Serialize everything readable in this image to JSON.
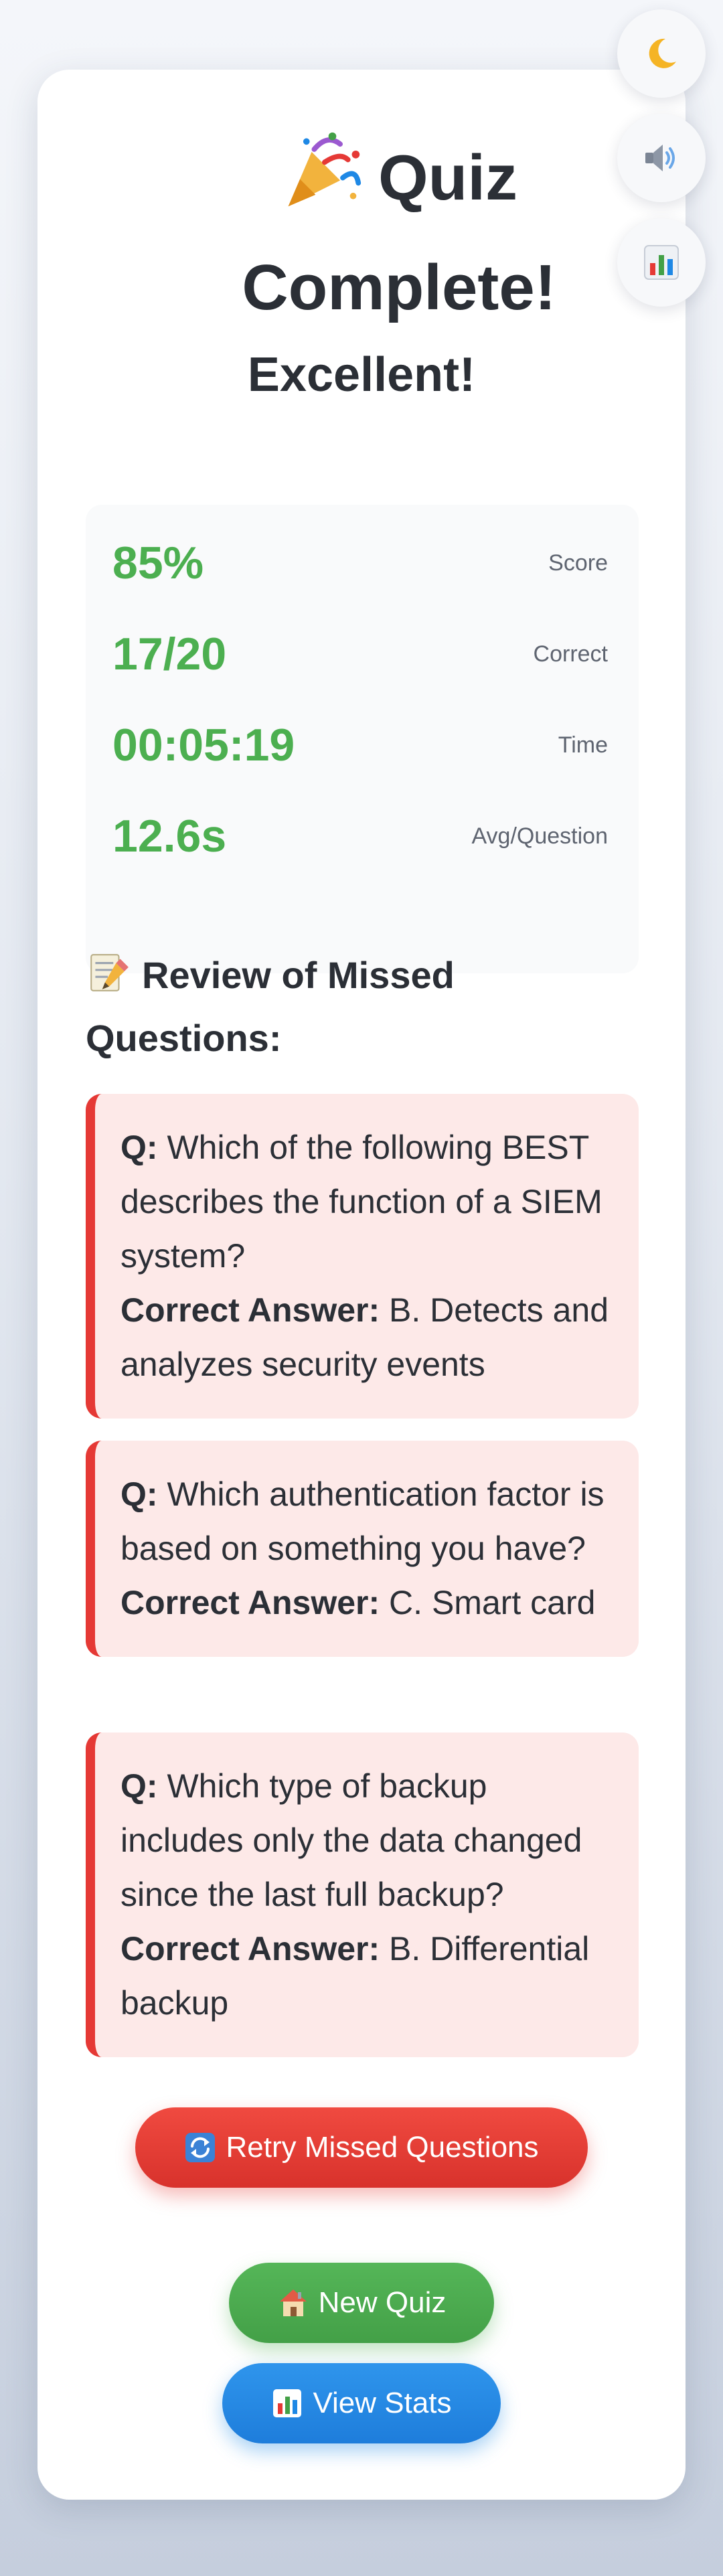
{
  "controls": {
    "theme_icon": "crescent-moon-icon",
    "sound_icon": "speaker-icon",
    "stats_icon": "bar-chart-icon"
  },
  "header": {
    "title_icon": "party-popper-icon",
    "title": "Quiz Complete!",
    "subtitle": "Excellent!"
  },
  "stats": [
    {
      "value": "85%",
      "label": "Score"
    },
    {
      "value": "17/20",
      "label": "Correct"
    },
    {
      "value": "00:05:19",
      "label": "Time"
    },
    {
      "value": "12.6s",
      "label": "Avg/Question"
    }
  ],
  "review": {
    "icon": "memo-icon",
    "heading": "Review of Missed Questions:",
    "question_prefix": "Q:",
    "answer_prefix": "Correct Answer:",
    "items": [
      {
        "question": "Which of the following BEST describes the function of a SIEM system?",
        "answer": "B. Detects and analyzes security events"
      },
      {
        "question": "Which authentication factor is based on something you have?",
        "answer": "C. Smart card"
      },
      {
        "question": "Which type of backup includes only the data changed since the last full backup?",
        "answer": "B. Differential backup"
      }
    ]
  },
  "actions": {
    "retry_icon": "repeat-arrows-icon",
    "retry_label": "Retry Missed Questions",
    "new_icon": "house-icon",
    "new_label": "New Quiz",
    "view_icon": "bar-chart-icon",
    "view_label": "View Stats"
  },
  "colors": {
    "stat_value": "#4caf50",
    "missed_border": "#e53935",
    "missed_background": "#fde9e8",
    "retry_button": "#e53935",
    "new_button": "#4caf50",
    "view_button": "#1e88e5"
  }
}
